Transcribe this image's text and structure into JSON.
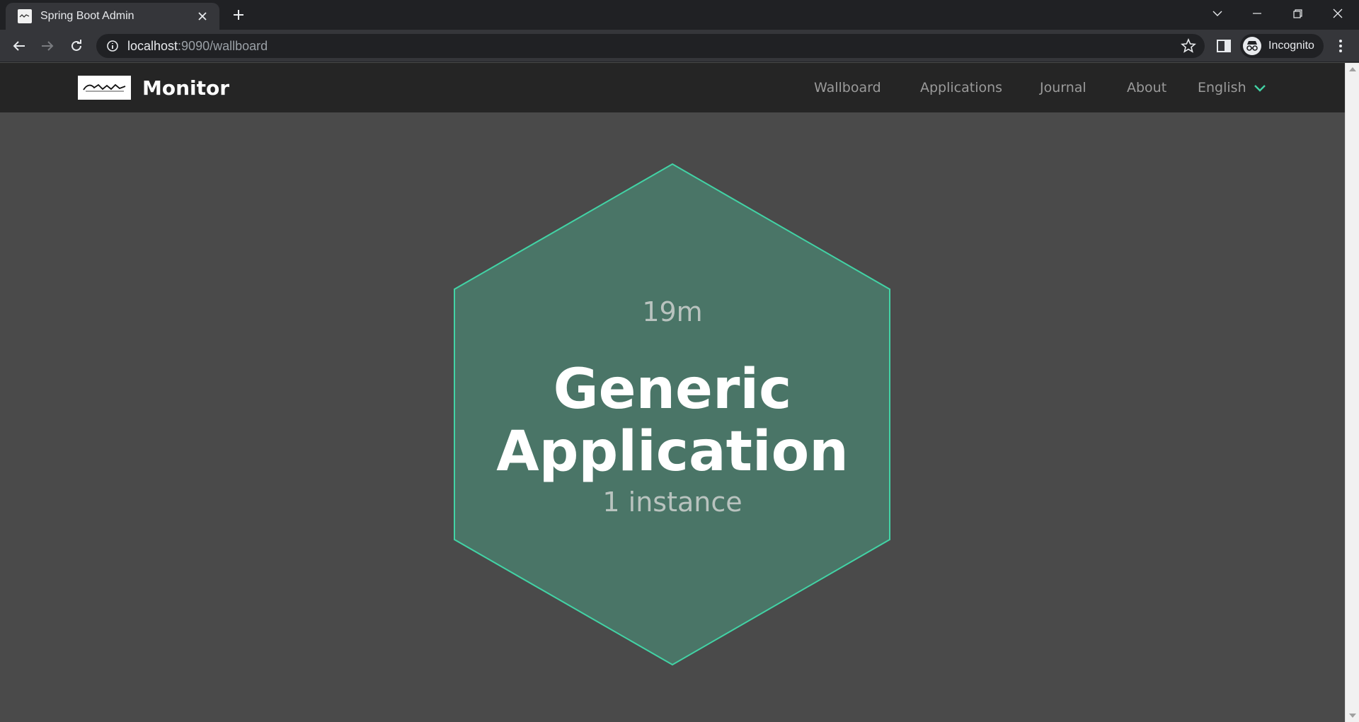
{
  "browser": {
    "tab_title": "Spring Boot Admin",
    "url_host": "localhost",
    "url_rest": ":9090/wallboard",
    "profile_label": "Incognito"
  },
  "app": {
    "brand": "Monitor",
    "nav": {
      "wallboard": "Wallboard",
      "applications": "Applications",
      "journal": "Journal",
      "about": "About",
      "language": "English"
    },
    "accent_color": "#42d3a5"
  },
  "wallboard": {
    "tiles": [
      {
        "uptime": "19m",
        "name": "Generic Application",
        "instances": "1 instance",
        "status_color": "#42d3a5",
        "fill_color": "#4a7567"
      }
    ]
  }
}
